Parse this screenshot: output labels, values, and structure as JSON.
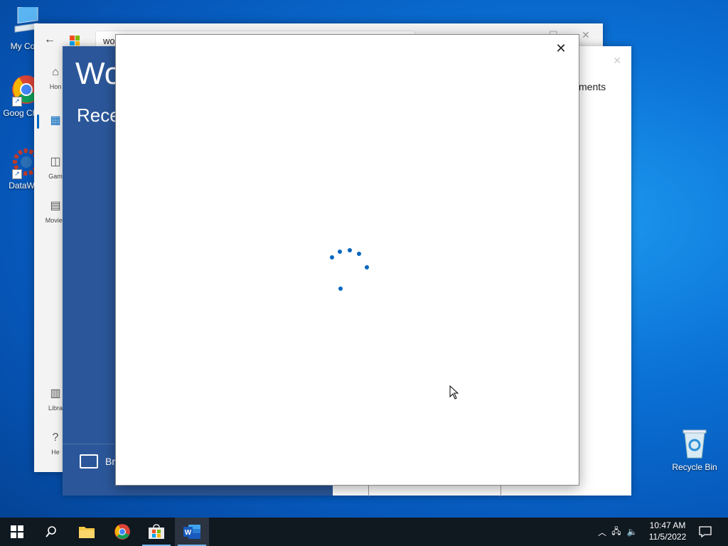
{
  "desktop": {
    "icons": [
      {
        "label": "My Com"
      },
      {
        "label": "Goog Chron"
      },
      {
        "label": "DataWag"
      }
    ],
    "recycle_bin": "Recycle Bin"
  },
  "store_window": {
    "search_value": "wo",
    "nav": {
      "home": "Hon",
      "gaming": "Gam",
      "movies": "Movies",
      "library": "Libra",
      "help": "He"
    }
  },
  "word_window": {
    "app_title": "Wo",
    "recent_heading": "Rece",
    "browse_label": "Browse",
    "right_heading": "ments"
  },
  "dialog": {
    "close_glyph": "✕",
    "state": "loading"
  },
  "taskbar": {
    "apps": [
      "start",
      "search",
      "file-explorer",
      "chrome",
      "microsoft-store",
      "word"
    ],
    "active_app": "word"
  },
  "clock": {
    "time": "10:47 AM",
    "date": "11/5/2022"
  },
  "colors": {
    "word_blue": "#2b579a",
    "accent": "#0067c0",
    "taskbar": "#101820"
  }
}
